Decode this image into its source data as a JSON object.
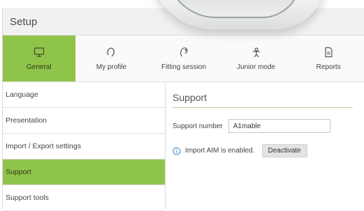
{
  "window": {
    "title": "Setup"
  },
  "tabs": [
    {
      "label": "General",
      "icon": "monitor-icon",
      "active": true
    },
    {
      "label": "My profile",
      "icon": "profile-icon",
      "active": false
    },
    {
      "label": "Fitting session",
      "icon": "hearing-aid-icon",
      "active": false
    },
    {
      "label": "Junior mode",
      "icon": "child-icon",
      "active": false
    },
    {
      "label": "Reports",
      "icon": "document-icon",
      "active": false
    }
  ],
  "sidebar": {
    "items": [
      {
        "label": "Language",
        "active": false
      },
      {
        "label": "Presentation",
        "active": false
      },
      {
        "label": "Import / Export settings",
        "active": false
      },
      {
        "label": "Support",
        "active": true
      },
      {
        "label": "Support tools",
        "active": false
      }
    ]
  },
  "main": {
    "title": "Support",
    "support_number_label": "Support number",
    "support_number_value": "A1mable",
    "info_text": "Import AIM is enabled.",
    "deactivate_label": "Deactivate"
  },
  "colors": {
    "accent": "#8fc44a",
    "info": "#3a86c8"
  }
}
